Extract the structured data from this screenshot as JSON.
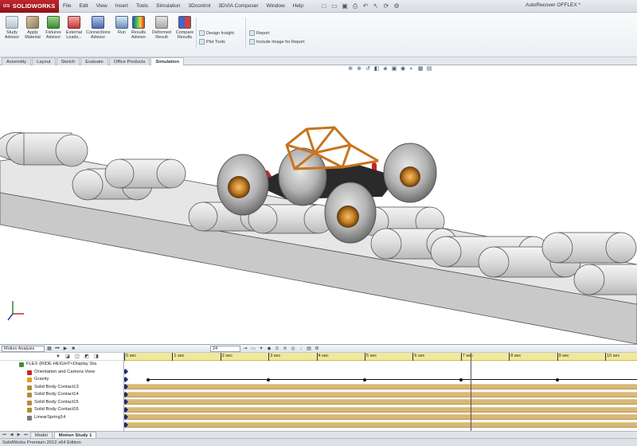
{
  "app": {
    "brand": "SOLIDWORKS",
    "brand_prefix": "DS",
    "document_title": "AutoRecover OFFLEX *"
  },
  "menu": [
    "File",
    "Edit",
    "View",
    "Insert",
    "Tools",
    "Simulation",
    "3Dcontrol",
    "3DVIA Composer",
    "Window",
    "Help"
  ],
  "ribbon": {
    "buttons": [
      {
        "label": "Study Advisor"
      },
      {
        "label": "Apply Material"
      },
      {
        "label": "Fixtures Advisor"
      },
      {
        "label": "External Loads..."
      },
      {
        "label": "Connections Advisor"
      },
      {
        "label": "Run"
      },
      {
        "label": "Results Advisor"
      },
      {
        "label": "Deformed Result"
      },
      {
        "label": "Compare Results"
      }
    ],
    "small_buttons": [
      "Design Insight",
      "Plot Tools",
      "Report",
      "Include Image for Report"
    ]
  },
  "tabs": [
    {
      "label": "Assembly",
      "active": false
    },
    {
      "label": "Layout",
      "active": false
    },
    {
      "label": "Sketch",
      "active": false
    },
    {
      "label": "Evaluate",
      "active": false
    },
    {
      "label": "Office Products",
      "active": false
    },
    {
      "label": "Simulation",
      "active": true
    }
  ],
  "view_tools": [
    "zoom-to-fit-icon",
    "zoom-area-icon",
    "previous-view-icon",
    "section-view-icon",
    "view-orientation-icon",
    "display-style-icon",
    "hide-show-icon",
    "appearance-icon",
    "scene-icon",
    "view-settings-icon"
  ],
  "motion": {
    "analysis_type": "Motion Analysis",
    "time_value": "24",
    "tree_items": [
      {
        "label": "FLEX  (RIDE HEIGHT<Display Sta",
        "icon": "assembly-icon",
        "color": "#4a8a3a"
      },
      {
        "label": "Orientation and Camera View",
        "icon": "camera-icon",
        "color": "#c02a2a"
      },
      {
        "label": "Gravity",
        "icon": "gravity-icon",
        "color": "#d8a020"
      },
      {
        "label": "Solid Body Contact13",
        "icon": "contact-icon",
        "color": "#b48a3a"
      },
      {
        "label": "Solid Body Contact14",
        "icon": "contact-icon",
        "color": "#b48a3a"
      },
      {
        "label": "Solid Body Contact15",
        "icon": "contact-icon",
        "color": "#b48a3a"
      },
      {
        "label": "Solid Body Contact16",
        "icon": "contact-icon",
        "color": "#b48a3a"
      },
      {
        "label": "LinearSpring14",
        "icon": "spring-icon",
        "color": "#7a7a7a"
      }
    ],
    "time_labels": [
      "0 sec",
      "1 sec",
      "2 sec",
      "3 sec",
      "4 sec",
      "5 sec",
      "6 sec",
      "7 sec",
      "8 sec",
      "9 sec",
      "10 sec"
    ],
    "current_time_sec": 7.2,
    "bottom_tabs": [
      {
        "label": "Model",
        "active": false
      },
      {
        "label": "Motion Study 1",
        "active": true
      }
    ]
  },
  "status": {
    "edition": "SolidWorks Premium 2012 x64 Edition"
  },
  "colors": {
    "brand_red": "#b01c22",
    "timeline_ruler": "#f2e89a",
    "contact_bar": "#d9b876",
    "frame_orange": "#c8741e",
    "suspension_red": "#c8232a"
  }
}
